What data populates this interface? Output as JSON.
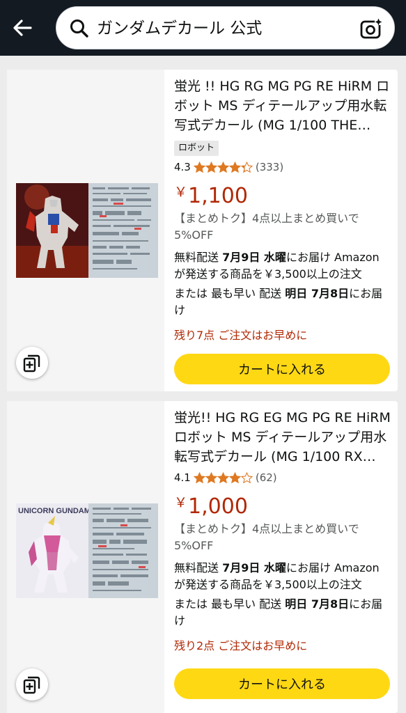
{
  "search": {
    "query": "ガンダムデカール 公式"
  },
  "products": [
    {
      "title": "蛍光 !! HG RG MG PG RE HiRM ロボット MS ディテールアップ用水転写式デカール (MG 1/100 THE…",
      "badge": "ロボット",
      "rating": "4.3",
      "stars": 4.3,
      "review_count": "(333)",
      "currency": "￥",
      "price": "1,100",
      "promo": "【まとめトク】4点以上まとめ買いで5%OFF",
      "shipping": {
        "prefix": "無料配送 ",
        "date": "7月9日 水曜",
        "suffix": "にお届け Amazon が発送する商品を￥3,500以上の注文"
      },
      "fastest": {
        "prefix": "または 最も早い 配送 ",
        "date": "明日 7月8日",
        "suffix": "にお届け"
      },
      "stock": "残り7点 ご注文はお早めに",
      "cart_label": "カートに入れる"
    },
    {
      "title": "蛍光!! HG RG EG MG PG RE HiRM ロボット MS ディテールアップ用水転写式デカール (MG 1/100 RX…",
      "badge": "",
      "rating": "4.1",
      "stars": 4.1,
      "review_count": "(62)",
      "currency": "￥",
      "price": "1,000",
      "promo": "【まとめトク】4点以上まとめ買いで5%OFF",
      "shipping": {
        "prefix": "無料配送 ",
        "date": "7月9日 水曜",
        "suffix": "にお届け Amazon が発送する商品を￥3,500以上の注文"
      },
      "fastest": {
        "prefix": "または 最も早い 配送 ",
        "date": "明日 7月8日",
        "suffix": "にお届け"
      },
      "stock": "残り2点 ご注文はお早めに",
      "cart_label": "カートに入れる",
      "image_text": "UNICORN GUNDAM"
    }
  ],
  "colors": {
    "header": "#131a22",
    "price": "#b12704",
    "star": "#de7921",
    "cart": "#ffd814"
  },
  "icons": {
    "back": "arrow-left-icon",
    "search": "search-icon",
    "camera": "camera-search-icon",
    "save": "add-to-list-icon"
  }
}
